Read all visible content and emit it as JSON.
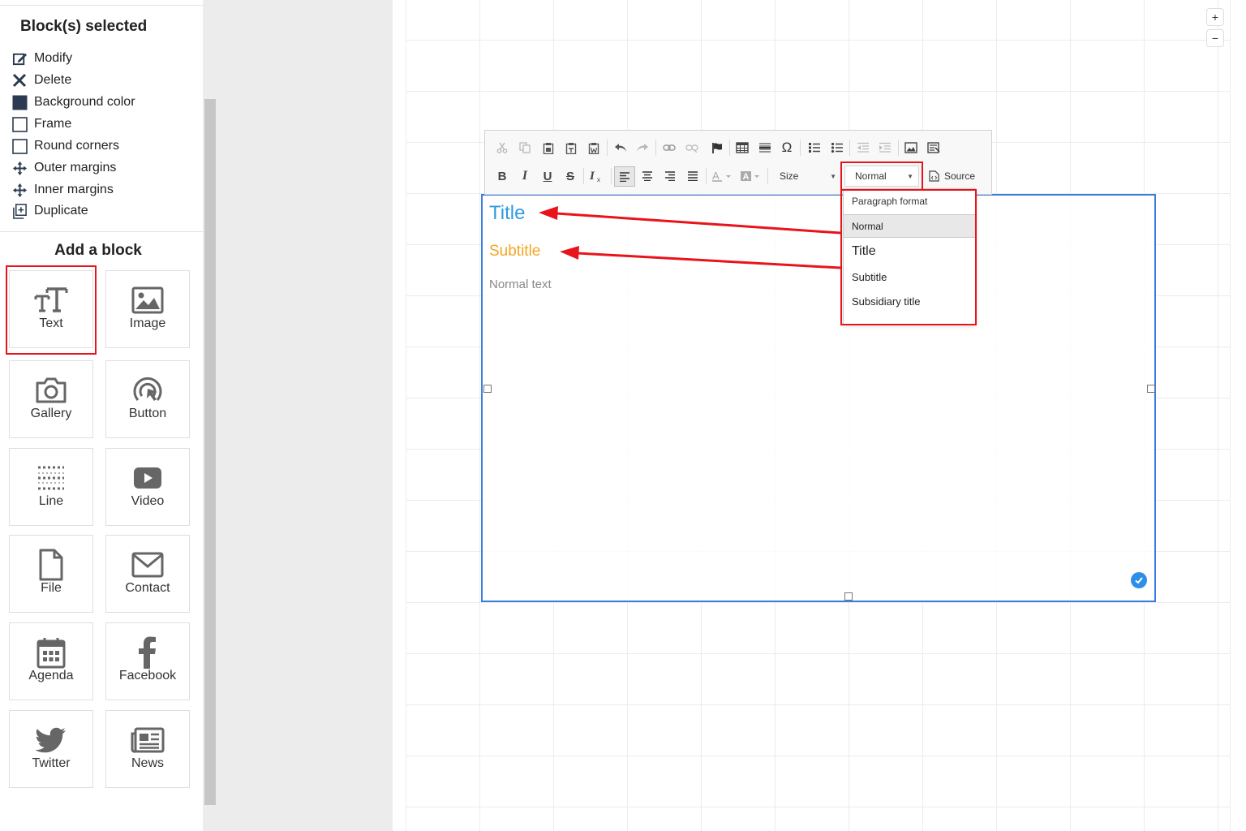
{
  "sidebar": {
    "selected_title": "Block(s) selected",
    "actions": [
      {
        "label": "Modify",
        "icon": "edit-icon"
      },
      {
        "label": "Delete",
        "icon": "close-icon"
      },
      {
        "label": "Background color",
        "icon": "filled-square-icon"
      },
      {
        "label": "Frame",
        "icon": "empty-square-icon"
      },
      {
        "label": "Round corners",
        "icon": "empty-square-icon"
      },
      {
        "label": "Outer margins",
        "icon": "move-arrows-icon"
      },
      {
        "label": "Inner margins",
        "icon": "move-arrows-icon"
      },
      {
        "label": "Duplicate",
        "icon": "duplicate-icon"
      }
    ],
    "add_title": "Add a block",
    "blocks": [
      {
        "label": "Text",
        "icon": "text-icon"
      },
      {
        "label": "Image",
        "icon": "image-icon"
      },
      {
        "label": "Gallery",
        "icon": "camera-icon"
      },
      {
        "label": "Button",
        "icon": "click-icon"
      },
      {
        "label": "Line",
        "icon": "line-icon"
      },
      {
        "label": "Video",
        "icon": "video-icon"
      },
      {
        "label": "File",
        "icon": "file-icon"
      },
      {
        "label": "Contact",
        "icon": "envelope-icon"
      },
      {
        "label": "Agenda",
        "icon": "calendar-icon"
      },
      {
        "label": "Facebook",
        "icon": "facebook-icon"
      },
      {
        "label": "Twitter",
        "icon": "twitter-icon"
      },
      {
        "label": "News",
        "icon": "newspaper-icon"
      }
    ]
  },
  "toolbar": {
    "size_label": "Size",
    "format_value": "Normal",
    "source_label": "Source"
  },
  "editor": {
    "title": "Title",
    "subtitle": "Subtitle",
    "normal": "Normal text"
  },
  "dropdown": {
    "header": "Paragraph format",
    "options": [
      "Normal",
      "Title",
      "Subtitle",
      "Subsidiary title"
    ]
  },
  "zoom": {
    "in": "+",
    "out": "−"
  },
  "colors": {
    "accent_blue": "#3a7de0",
    "title_blue": "#2f9be0",
    "subtitle_orange": "#f5a623",
    "annotation_red": "#e8141c"
  }
}
